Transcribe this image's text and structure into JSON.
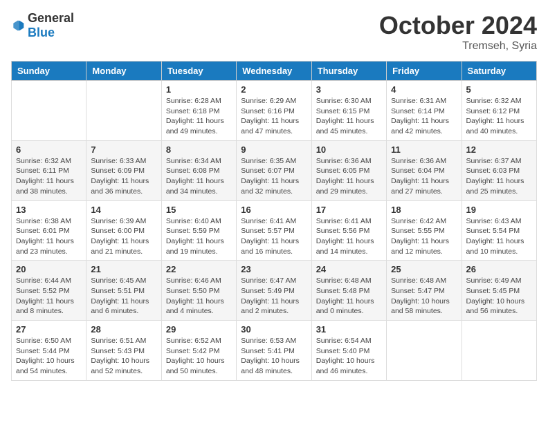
{
  "header": {
    "logo_general": "General",
    "logo_blue": "Blue",
    "month_title": "October 2024",
    "location": "Tremseh, Syria"
  },
  "weekdays": [
    "Sunday",
    "Monday",
    "Tuesday",
    "Wednesday",
    "Thursday",
    "Friday",
    "Saturday"
  ],
  "weeks": [
    [
      {
        "day": "",
        "info": ""
      },
      {
        "day": "",
        "info": ""
      },
      {
        "day": "1",
        "info": "Sunrise: 6:28 AM\nSunset: 6:18 PM\nDaylight: 11 hours and 49 minutes."
      },
      {
        "day": "2",
        "info": "Sunrise: 6:29 AM\nSunset: 6:16 PM\nDaylight: 11 hours and 47 minutes."
      },
      {
        "day": "3",
        "info": "Sunrise: 6:30 AM\nSunset: 6:15 PM\nDaylight: 11 hours and 45 minutes."
      },
      {
        "day": "4",
        "info": "Sunrise: 6:31 AM\nSunset: 6:14 PM\nDaylight: 11 hours and 42 minutes."
      },
      {
        "day": "5",
        "info": "Sunrise: 6:32 AM\nSunset: 6:12 PM\nDaylight: 11 hours and 40 minutes."
      }
    ],
    [
      {
        "day": "6",
        "info": "Sunrise: 6:32 AM\nSunset: 6:11 PM\nDaylight: 11 hours and 38 minutes."
      },
      {
        "day": "7",
        "info": "Sunrise: 6:33 AM\nSunset: 6:09 PM\nDaylight: 11 hours and 36 minutes."
      },
      {
        "day": "8",
        "info": "Sunrise: 6:34 AM\nSunset: 6:08 PM\nDaylight: 11 hours and 34 minutes."
      },
      {
        "day": "9",
        "info": "Sunrise: 6:35 AM\nSunset: 6:07 PM\nDaylight: 11 hours and 32 minutes."
      },
      {
        "day": "10",
        "info": "Sunrise: 6:36 AM\nSunset: 6:05 PM\nDaylight: 11 hours and 29 minutes."
      },
      {
        "day": "11",
        "info": "Sunrise: 6:36 AM\nSunset: 6:04 PM\nDaylight: 11 hours and 27 minutes."
      },
      {
        "day": "12",
        "info": "Sunrise: 6:37 AM\nSunset: 6:03 PM\nDaylight: 11 hours and 25 minutes."
      }
    ],
    [
      {
        "day": "13",
        "info": "Sunrise: 6:38 AM\nSunset: 6:01 PM\nDaylight: 11 hours and 23 minutes."
      },
      {
        "day": "14",
        "info": "Sunrise: 6:39 AM\nSunset: 6:00 PM\nDaylight: 11 hours and 21 minutes."
      },
      {
        "day": "15",
        "info": "Sunrise: 6:40 AM\nSunset: 5:59 PM\nDaylight: 11 hours and 19 minutes."
      },
      {
        "day": "16",
        "info": "Sunrise: 6:41 AM\nSunset: 5:57 PM\nDaylight: 11 hours and 16 minutes."
      },
      {
        "day": "17",
        "info": "Sunrise: 6:41 AM\nSunset: 5:56 PM\nDaylight: 11 hours and 14 minutes."
      },
      {
        "day": "18",
        "info": "Sunrise: 6:42 AM\nSunset: 5:55 PM\nDaylight: 11 hours and 12 minutes."
      },
      {
        "day": "19",
        "info": "Sunrise: 6:43 AM\nSunset: 5:54 PM\nDaylight: 11 hours and 10 minutes."
      }
    ],
    [
      {
        "day": "20",
        "info": "Sunrise: 6:44 AM\nSunset: 5:52 PM\nDaylight: 11 hours and 8 minutes."
      },
      {
        "day": "21",
        "info": "Sunrise: 6:45 AM\nSunset: 5:51 PM\nDaylight: 11 hours and 6 minutes."
      },
      {
        "day": "22",
        "info": "Sunrise: 6:46 AM\nSunset: 5:50 PM\nDaylight: 11 hours and 4 minutes."
      },
      {
        "day": "23",
        "info": "Sunrise: 6:47 AM\nSunset: 5:49 PM\nDaylight: 11 hours and 2 minutes."
      },
      {
        "day": "24",
        "info": "Sunrise: 6:48 AM\nSunset: 5:48 PM\nDaylight: 11 hours and 0 minutes."
      },
      {
        "day": "25",
        "info": "Sunrise: 6:48 AM\nSunset: 5:47 PM\nDaylight: 10 hours and 58 minutes."
      },
      {
        "day": "26",
        "info": "Sunrise: 6:49 AM\nSunset: 5:45 PM\nDaylight: 10 hours and 56 minutes."
      }
    ],
    [
      {
        "day": "27",
        "info": "Sunrise: 6:50 AM\nSunset: 5:44 PM\nDaylight: 10 hours and 54 minutes."
      },
      {
        "day": "28",
        "info": "Sunrise: 6:51 AM\nSunset: 5:43 PM\nDaylight: 10 hours and 52 minutes."
      },
      {
        "day": "29",
        "info": "Sunrise: 6:52 AM\nSunset: 5:42 PM\nDaylight: 10 hours and 50 minutes."
      },
      {
        "day": "30",
        "info": "Sunrise: 6:53 AM\nSunset: 5:41 PM\nDaylight: 10 hours and 48 minutes."
      },
      {
        "day": "31",
        "info": "Sunrise: 6:54 AM\nSunset: 5:40 PM\nDaylight: 10 hours and 46 minutes."
      },
      {
        "day": "",
        "info": ""
      },
      {
        "day": "",
        "info": ""
      }
    ]
  ]
}
